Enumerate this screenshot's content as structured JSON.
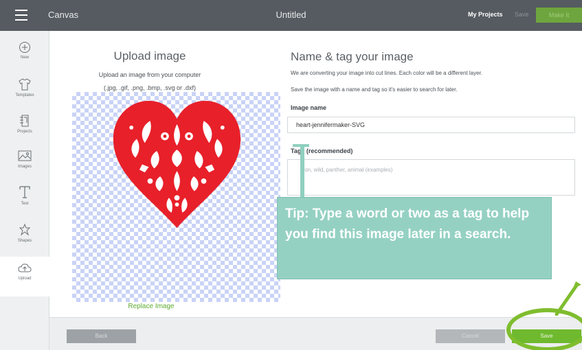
{
  "topbar": {
    "app_name": "Canvas",
    "doc_title": "Untitled",
    "my_projects": "My Projects",
    "save": "Save",
    "make_it": "Make It"
  },
  "sidebar": {
    "items": [
      {
        "label": "New",
        "icon": "plus-circle-icon"
      },
      {
        "label": "Templates",
        "icon": "shirt-icon"
      },
      {
        "label": "Projects",
        "icon": "projects-icon"
      },
      {
        "label": "Images",
        "icon": "image-icon"
      },
      {
        "label": "Text",
        "icon": "text-icon"
      },
      {
        "label": "Shapes",
        "icon": "shapes-icon"
      },
      {
        "label": "Upload",
        "icon": "upload-cloud-icon"
      }
    ],
    "active": "Upload"
  },
  "upload": {
    "title": "Upload image",
    "subtitle_line1": "Upload an image from your computer",
    "subtitle_line2": "(.jpg, .gif, .png, .bmp, .svg or .dxf)",
    "replace": "Replace Image"
  },
  "name_tag": {
    "title": "Name & tag your image",
    "desc1": "We are converting your image into cut lines. Each color will be a different layer.",
    "desc2": "Save the image with a name and tag so it's easier to search for later.",
    "image_name_label": "Image name",
    "image_name_value": "heart-jennifermaker-SVG",
    "tags_label": "Tags (recommended)",
    "tags_placeholder": "Lion, wild, panther, animal (examples)"
  },
  "tip": {
    "text": "Tip: Type a word or two as a tag to help you find this image later in a search."
  },
  "bottom": {
    "back": "Back",
    "cancel": "Cancel",
    "save": "Save"
  },
  "colors": {
    "topbar": "#555b60",
    "accent_green": "#6fb92f",
    "tip_teal": "#95d1c3",
    "heart_red": "#e8202a"
  }
}
